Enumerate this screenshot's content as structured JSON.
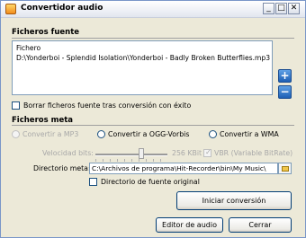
{
  "window": {
    "title": "Convertidor audio",
    "minimize": "_",
    "maximize": "□",
    "close": "✕"
  },
  "source": {
    "section_title": "Ficheros fuente",
    "files": [
      "Fichero",
      "D:\\Yonderboi - Splendid Isolation\\Yonderboi - Badly Broken Butterflies.mp3"
    ],
    "add_label": "+",
    "remove_label": "−",
    "delete_checkbox_label": "Borrar ficheros fuente tras conversión con éxito",
    "delete_checked": false
  },
  "meta": {
    "section_title": "Ficheros meta",
    "radios": [
      {
        "label": "Convertir a MP3",
        "disabled": true,
        "selected": false
      },
      {
        "label": "Convertir a OGG-Vorbis",
        "disabled": false,
        "selected": false
      },
      {
        "label": "Convertir a WMA",
        "disabled": false,
        "selected": false
      }
    ],
    "bitrate_label": "Velocidad bits:",
    "bitrate_value": "256 KBit",
    "vbr_label": "VBR (Variable BitRate)",
    "vbr_checked": true,
    "dir_label": "Directorio meta:",
    "dir_value": "C:\\Archivos de programa\\Hit-Recorder\\bin\\My Music\\",
    "source_dir_label": "Directorio de fuente original",
    "source_dir_checked": false
  },
  "buttons": {
    "start": "Iniciar conversión",
    "editor": "Editor de audio",
    "close": "Cerrar"
  }
}
